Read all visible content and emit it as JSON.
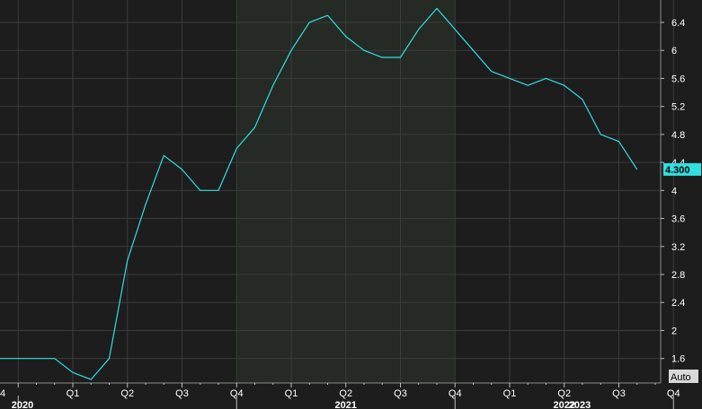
{
  "chart_data": {
    "type": "line",
    "title": "",
    "xlabel": "",
    "ylabel": "",
    "ylim": [
      1.25,
      6.72
    ],
    "y_ticks": [
      1.6,
      2,
      2.4,
      2.8,
      3.2,
      3.6,
      4,
      4.4,
      4.8,
      5.2,
      5.6,
      6,
      6.4
    ],
    "y_tick_labels": [
      "1.6",
      "2",
      "2.4",
      "2.8",
      "3.2",
      "3.6",
      "4",
      "4.4",
      "4.8",
      "5.2",
      "5.6",
      "6",
      "6.4"
    ],
    "x_quarter_labels": [
      "4",
      "Q1",
      "Q2",
      "Q3",
      "Q4",
      "Q1",
      "Q2",
      "Q3",
      "Q4",
      "Q1",
      "Q2",
      "Q3",
      "Q4"
    ],
    "x_year_labels": [
      "2020",
      "2021",
      "2022",
      "2023"
    ],
    "grid": true,
    "line_color": "#30e0e0",
    "x": [
      "2019-12",
      "2020-01",
      "2020-02",
      "2020-03",
      "2020-04",
      "2020-05",
      "2020-06",
      "2020-07",
      "2020-08",
      "2020-09",
      "2020-10",
      "2020-11",
      "2020-12",
      "2021-01",
      "2021-02",
      "2021-03",
      "2021-04",
      "2021-05",
      "2021-06",
      "2021-07",
      "2021-08",
      "2021-09",
      "2021-10",
      "2021-11",
      "2021-12",
      "2022-01",
      "2022-02",
      "2022-03",
      "2022-04",
      "2022-05",
      "2022-06",
      "2022-07",
      "2022-08",
      "2022-09",
      "2022-10",
      "2022-11",
      "2022-12",
      "2023-01",
      "2023-02",
      "2023-03",
      "2023-04",
      "2023-05",
      "2023-06",
      "2023-07",
      "2023-08",
      "2023-09",
      "2023-10"
    ],
    "series": [
      {
        "values": [
          1.6,
          1.6,
          1.6,
          1.6,
          1.4,
          1.3,
          1.6,
          3.0,
          3.8,
          4.5,
          4.3,
          4.0,
          4.0,
          4.6,
          4.9,
          5.5,
          6.0,
          6.4,
          6.5,
          6.2,
          6.0,
          5.9,
          5.9,
          6.3,
          6.6,
          6.3,
          6.0,
          5.7,
          5.6,
          5.5,
          5.6,
          5.5,
          5.3,
          4.8,
          4.7,
          4.3
        ]
      }
    ],
    "last_value_label": "4.300",
    "scale_button_label": "Auto",
    "colors": {
      "background": "#1d1d1d",
      "shaded_band": "#252a24",
      "gridline": "#3a3d3a",
      "line": "#30e0e0",
      "last_value_badge": "#30e0e0",
      "auto_badge": "#d8d8d8"
    }
  }
}
